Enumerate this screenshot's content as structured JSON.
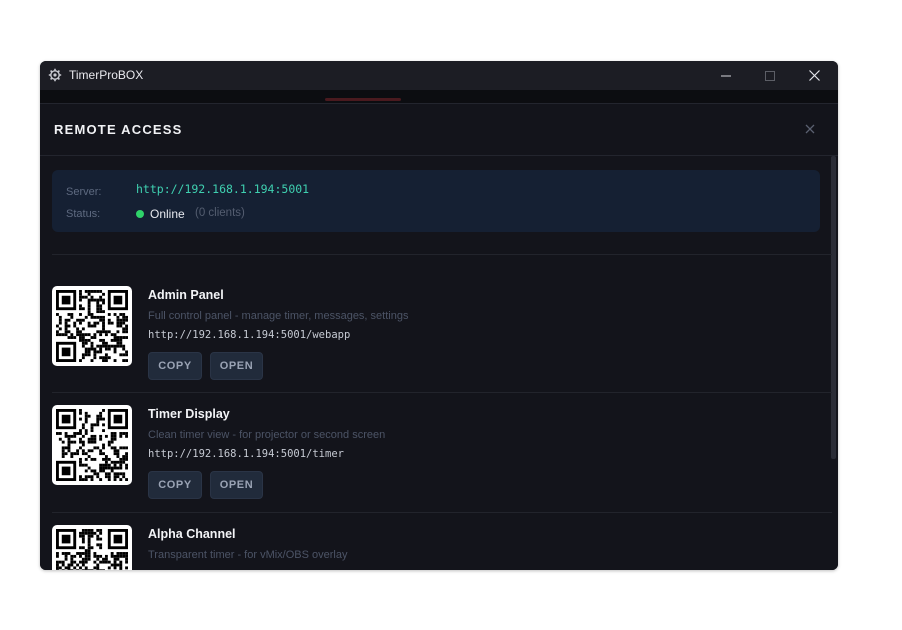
{
  "window": {
    "title": "TimerProBOX",
    "icons": {
      "app": "gear-icon",
      "minimize": "minimize-icon",
      "maximize": "maximize-icon",
      "close": "close-icon"
    }
  },
  "modal": {
    "title": "REMOTE ACCESS",
    "close_icon": "close-icon",
    "server_label": "Server:",
    "server_url": "http://192.168.1.194:5001",
    "status_label": "Status:",
    "status_value": "Online",
    "status_clients": "(0 clients)",
    "colors": {
      "online": "#2fd36a",
      "url": "#3fd0b0"
    }
  },
  "entries": [
    {
      "title": "Admin Panel",
      "description": "Full control panel - manage timer, messages, settings",
      "url": "http://192.168.1.194:5001/webapp",
      "copy_label": "COPY",
      "open_label": "OPEN",
      "qr_icon": "qr-code-icon"
    },
    {
      "title": "Timer Display",
      "description": "Clean timer view - for projector or second screen",
      "url": "http://192.168.1.194:5001/timer",
      "copy_label": "COPY",
      "open_label": "OPEN",
      "qr_icon": "qr-code-icon"
    },
    {
      "title": "Alpha Channel",
      "description": "Transparent timer - for vMix/OBS overlay",
      "qr_icon": "qr-code-icon"
    }
  ]
}
